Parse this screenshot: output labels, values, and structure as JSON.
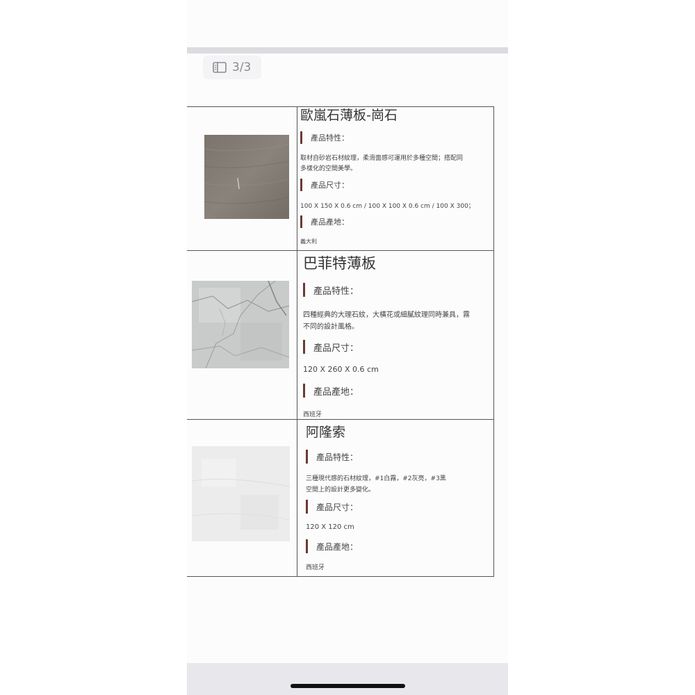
{
  "pager": {
    "icon": "sidebar-panel-icon",
    "label": "3/3"
  },
  "colors": {
    "accent_bar": "#6b3b32",
    "border": "#555555"
  },
  "products": [
    {
      "title": "歐嵐石薄板-崗石",
      "image": "granite-gray-tile",
      "feature_heading": "產品特性：",
      "feature_lines": [
        "取材自砂岩石材紋理，柔滑面感可運用於多種空間；搭配同",
        "多樣化的空間美學。"
      ],
      "size_heading": "產品尺寸：",
      "size": "100 X 150 X 0.6 cm / 100 X 100 X 0.6 cm / 100 X 300；",
      "origin_heading": "產品產地：",
      "origin": "義大利"
    },
    {
      "title": "巴菲特薄板",
      "image": "marble-gray-tile",
      "feature_heading": "產品特性：",
      "feature_lines": [
        "四種經典的大理石紋，大橫花或細膩紋理同時兼具，霧",
        "不同的設計風格。"
      ],
      "size_heading": "產品尺寸：",
      "size": "120 X  260 X 0.6 cm",
      "origin_heading": "產品產地：",
      "origin": "西班牙"
    },
    {
      "title": "阿隆索",
      "image": "white-stone-tile",
      "feature_heading": "產品特性：",
      "feature_lines": [
        "三種現代感的石材紋理，#1白霧，#2灰亮，#3黑",
        "空間上的設計更多變化。"
      ],
      "size_heading": "產品尺寸：",
      "size": "120 X  120 cm",
      "origin_heading": "產品產地：",
      "origin": "西班牙"
    }
  ]
}
